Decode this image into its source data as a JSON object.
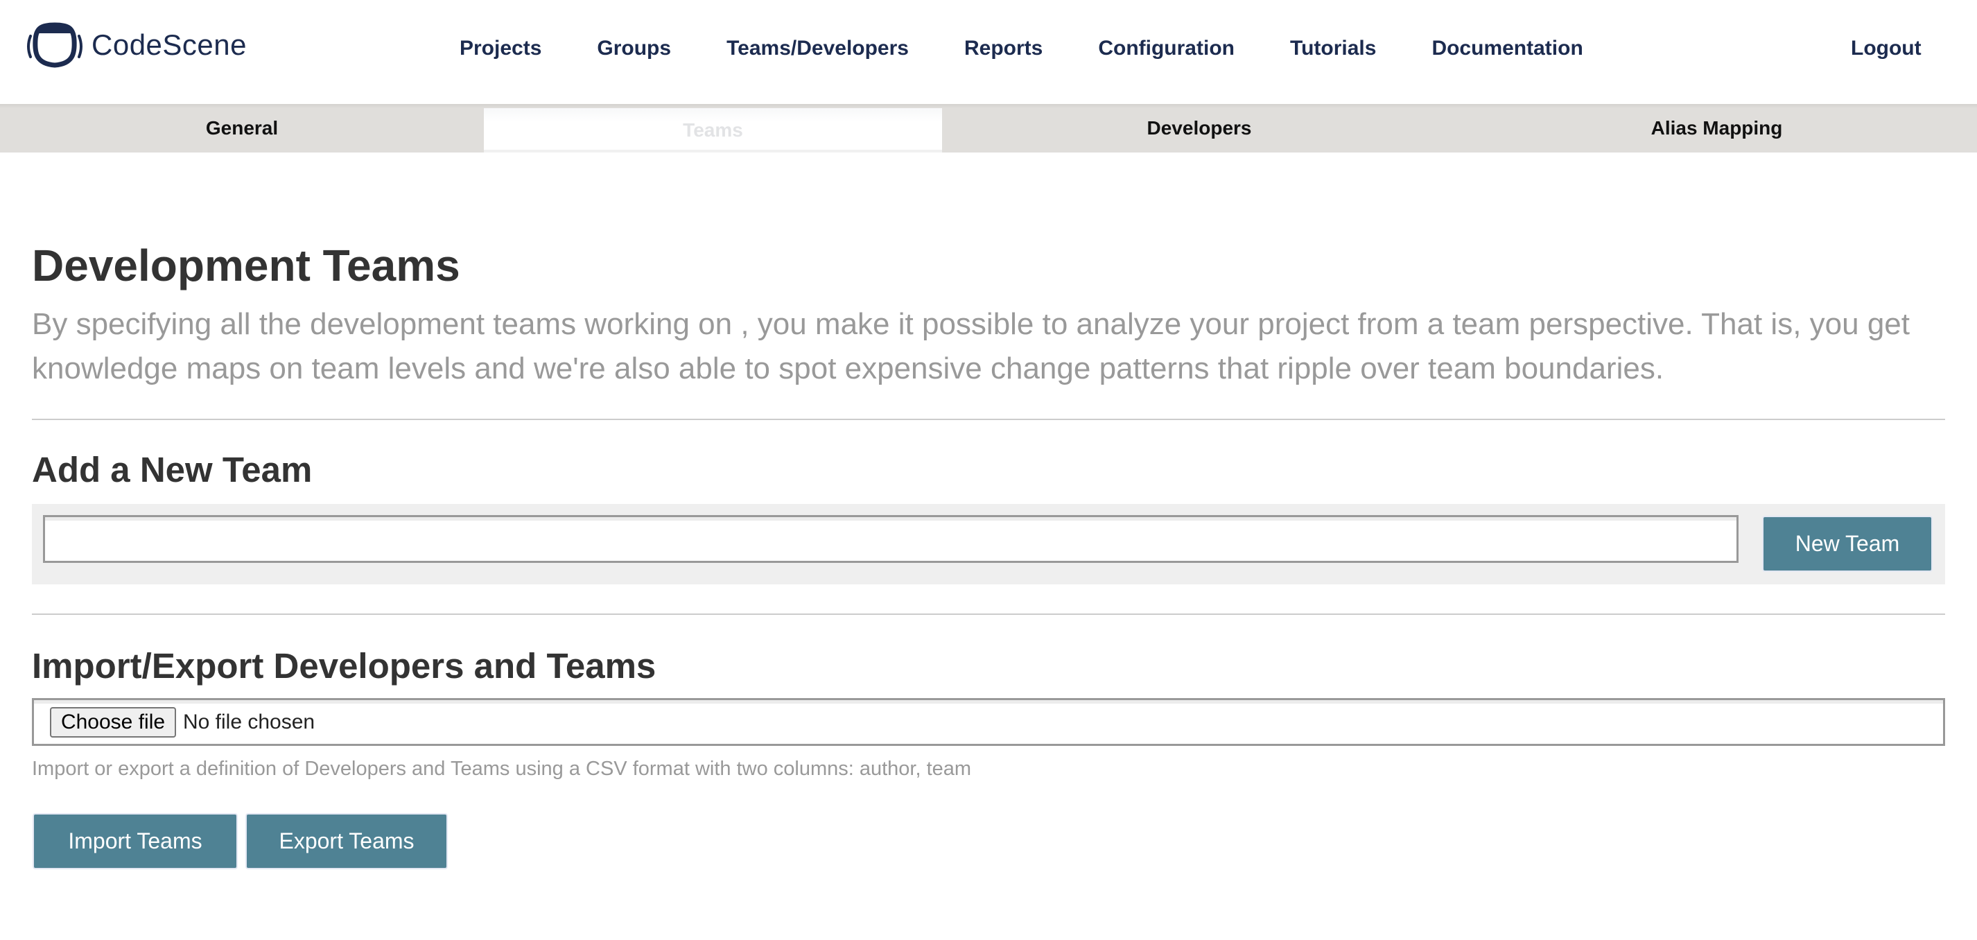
{
  "brand": {
    "name": "CodeScene",
    "logo_icon": "codescene-logo-icon",
    "color": "#1c2b4f"
  },
  "nav": {
    "items": [
      {
        "label": "Projects"
      },
      {
        "label": "Groups"
      },
      {
        "label": "Teams/Developers"
      },
      {
        "label": "Reports"
      },
      {
        "label": "Configuration"
      },
      {
        "label": "Tutorials"
      },
      {
        "label": "Documentation"
      }
    ],
    "logout_label": "Logout"
  },
  "subtabs": {
    "items": [
      {
        "label": "General",
        "active": false
      },
      {
        "label": "Teams",
        "active": true
      },
      {
        "label": "Developers",
        "active": false
      },
      {
        "label": "Alias Mapping",
        "active": false
      }
    ]
  },
  "page": {
    "title": "Development Teams",
    "description": "By specifying all the development teams working on , you make it possible to analyze your project from a team perspective. That is, you get knowledge maps on team levels and we're also able to spot expensive change patterns that ripple over team boundaries."
  },
  "add_team": {
    "title": "Add a New Team",
    "input_value": "",
    "input_placeholder": "",
    "button_label": "New Team"
  },
  "import_export": {
    "title": "Import/Export Developers and Teams",
    "choose_file_label": "Choose file",
    "file_status": "No file chosen",
    "hint": "Import or export a definition of Developers and Teams using a CSV format with two columns: author, team",
    "import_label": "Import Teams",
    "export_label": "Export Teams"
  },
  "colors": {
    "accent_button": "#4f8294",
    "nav_text": "#1c2b4f",
    "heading_text": "#333333",
    "muted_text": "#999999",
    "tab_bar_bg": "#e0dedb"
  }
}
